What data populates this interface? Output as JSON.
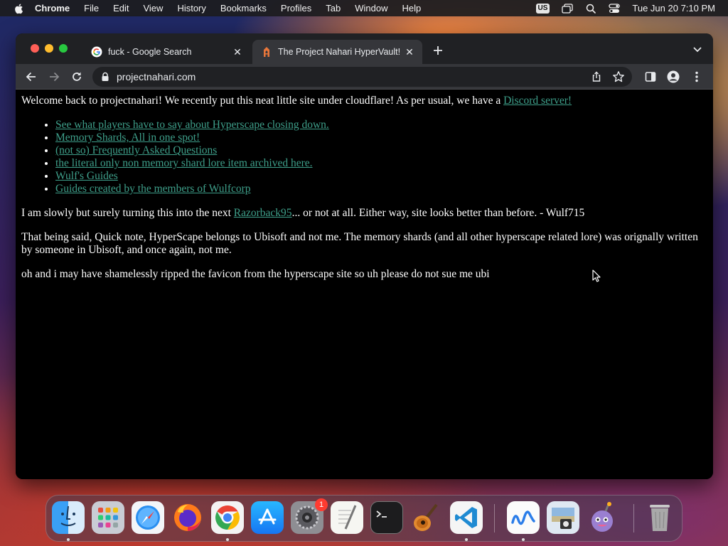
{
  "menubar": {
    "app_name": "Chrome",
    "items": [
      "File",
      "Edit",
      "View",
      "History",
      "Bookmarks",
      "Profiles",
      "Tab",
      "Window",
      "Help"
    ],
    "input_source": "US",
    "clock": "Tue Jun 20  7:10 PM"
  },
  "browser": {
    "tabs": [
      {
        "title": "fuck - Google Search",
        "favicon": "google-g-icon",
        "active": false
      },
      {
        "title": "The Project Nahari HyperVault!",
        "favicon": "hyperscape-icon",
        "active": true
      }
    ],
    "address": "projectnahari.com"
  },
  "page": {
    "intro": "Welcome back to projectnahari! We recently put this neat little site under cloudflare! As per usual, we have a ",
    "discord_link": "Discord server!",
    "links": [
      "See what players have to say about Hyperscape closing down.",
      "Memory Shards, All in one spot!",
      "(not so) Frequently Asked Questions",
      "the literal only non memory shard lore item archived here.",
      "Wulf's Guides",
      "Guides created by the members of Wulfcorp"
    ],
    "para2_before": "I am slowly but surely turning this into the next ",
    "para2_link": "Razorback95",
    "para2_after": "... or not at all. Either way, site looks better than before. - Wulf715",
    "para3": "That being said, Quick note, HyperScape belongs to Ubisoft and not me. The memory shards (and all other hyperscape related lore) was orignally written by someone in Ubisoft, and once again, not me.",
    "para4": "oh and i may have shamelessly ripped the favicon from the hyperscape site so uh please do not sue me ubi",
    "link_color": "#3e9f8a"
  },
  "dock": {
    "apps": [
      {
        "name": "finder-icon",
        "running": true
      },
      {
        "name": "launchpad-icon",
        "running": false
      },
      {
        "name": "safari-icon",
        "running": false
      },
      {
        "name": "firefox-icon",
        "running": false
      },
      {
        "name": "chrome-icon",
        "running": true
      },
      {
        "name": "app-store-icon",
        "running": false
      },
      {
        "name": "system-settings-icon",
        "running": false,
        "badge": "1"
      },
      {
        "name": "textedit-icon",
        "running": false
      },
      {
        "name": "terminal-icon",
        "running": false
      },
      {
        "name": "garageband-icon",
        "running": false
      },
      {
        "name": "vscode-icon",
        "running": true
      },
      {
        "name": "freeform-icon",
        "running": true
      },
      {
        "name": "preview-icon",
        "running": false
      },
      {
        "name": "bomb-character-icon",
        "running": false
      },
      {
        "name": "trash-icon",
        "running": false
      }
    ]
  }
}
